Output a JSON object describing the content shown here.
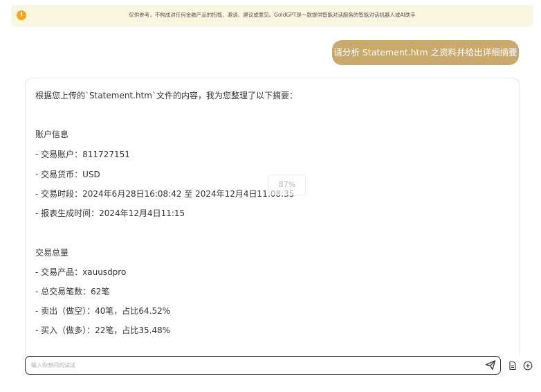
{
  "banner": {
    "icon": "info-icon",
    "icon_glyph": "!",
    "text": "仅供参考，不构成对任何金融产品的招揽、邀请、建议或意见。GoldGPT是一款提供智能对话服务的智能对话机器人或AI助手"
  },
  "user_message": {
    "text": "请分析 Statement.htm 之资料并给出详细摘要"
  },
  "answer": {
    "lines": [
      "根据您上传的`Statement.htm`文件的内容，我为您整理了以下摘要：",
      "账户信息",
      "- 交易账户：811727151",
      "- 交易货币：USD",
      "- 交易时段：2024年6月28日16:08:42 至 2024年12月4日11:08:35",
      "- 报表生成时间：2024年12月4日11:15",
      "交易总量",
      "- 交易产品：xauusdpro",
      "- 总交易笔数：62笔",
      "- 卖出（做空）：40笔，占比64.52%",
      "- 买入（做多）：22笔，占比35.48%"
    ]
  },
  "zoom_badge": "87%",
  "input": {
    "placeholder": "输入你想问的试试",
    "value": ""
  },
  "icons": {
    "send": "send-icon",
    "file": "file-icon",
    "add": "plus-circle-icon"
  },
  "colors": {
    "accent": "#c9a96c",
    "banner_bg": "#fbf6df",
    "info_icon": "#f3a623"
  }
}
